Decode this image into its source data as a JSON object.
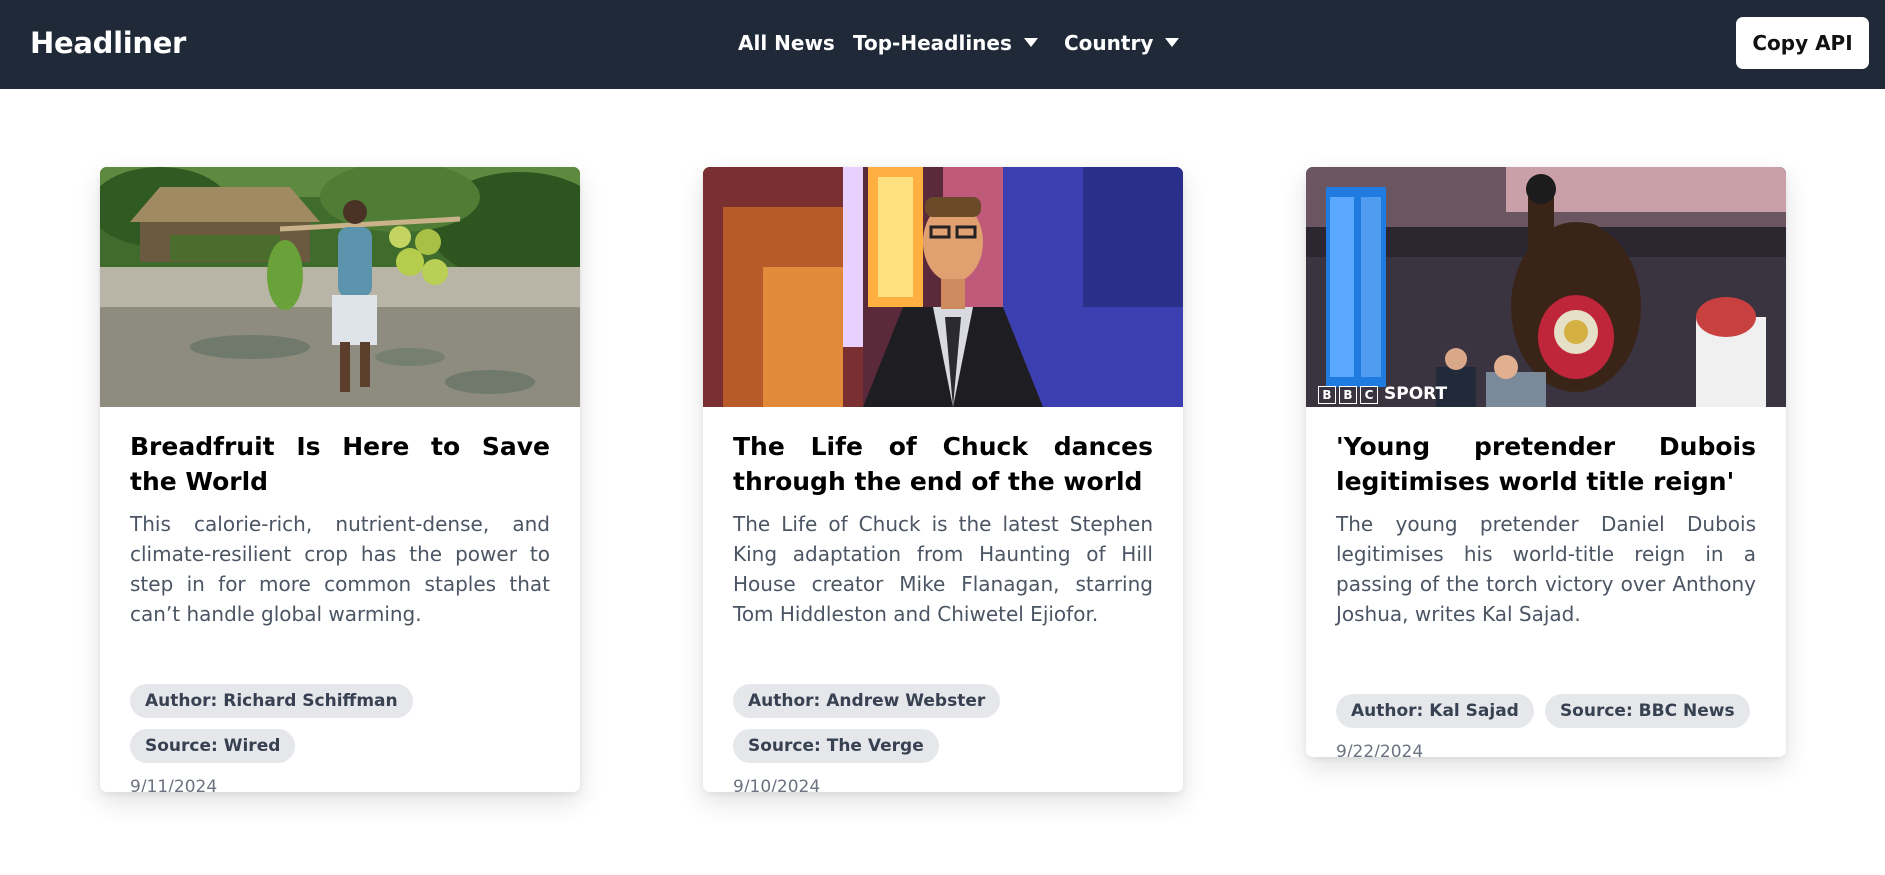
{
  "app": {
    "brand": "Headliner"
  },
  "nav": {
    "all_news": "All News",
    "top_headlines": "Top-Headlines",
    "country": "Country"
  },
  "actions": {
    "copy_api": "Copy API"
  },
  "icons": {
    "dropdown": "caret-down-icon"
  },
  "colors": {
    "navbar_bg": "#1f2937",
    "tag_bg": "#e5e7eb",
    "page_bg": "#ffffff"
  },
  "articles": [
    {
      "title": "Breadfruit Is Here to Save the World",
      "description": "This calorie-rich, nutrient-dense, and climate-resilient crop has the power to step in for more common staples that can’t handle global warming.",
      "author": "Author: Richard Schiffman",
      "source": "Source: Wired",
      "date": "9/11/2024",
      "image": "man carrying breadfruit on a pole along a muddy road"
    },
    {
      "title": "The Life of Chuck dances through the end of the world",
      "description": "The Life of Chuck is the latest Stephen King adaptation from Haunting of Hill House creator Mike Flanagan, starring Tom Hiddleston and Chiwetel Ejiofor.",
      "author": "Author: Andrew Webster",
      "source": "Source: The Verge",
      "date": "9/10/2024",
      "image": "man in suit and glasses in front of neon marquee lights"
    },
    {
      "title": "'Young pretender Dubois legitimises world title reign'",
      "description": "The young pretender Daniel Dubois legitimises his world-title reign in a passing of the torch victory over Anthony Joshua, writes Kal Sajad.",
      "author": "Author: Kal Sajad",
      "source": "Source: BBC News",
      "date": "9/22/2024",
      "image": "boxer raising fist holding championship belt in arena",
      "image_watermark": {
        "letters": [
          "B",
          "B",
          "C"
        ],
        "label": "SPORT"
      }
    }
  ]
}
